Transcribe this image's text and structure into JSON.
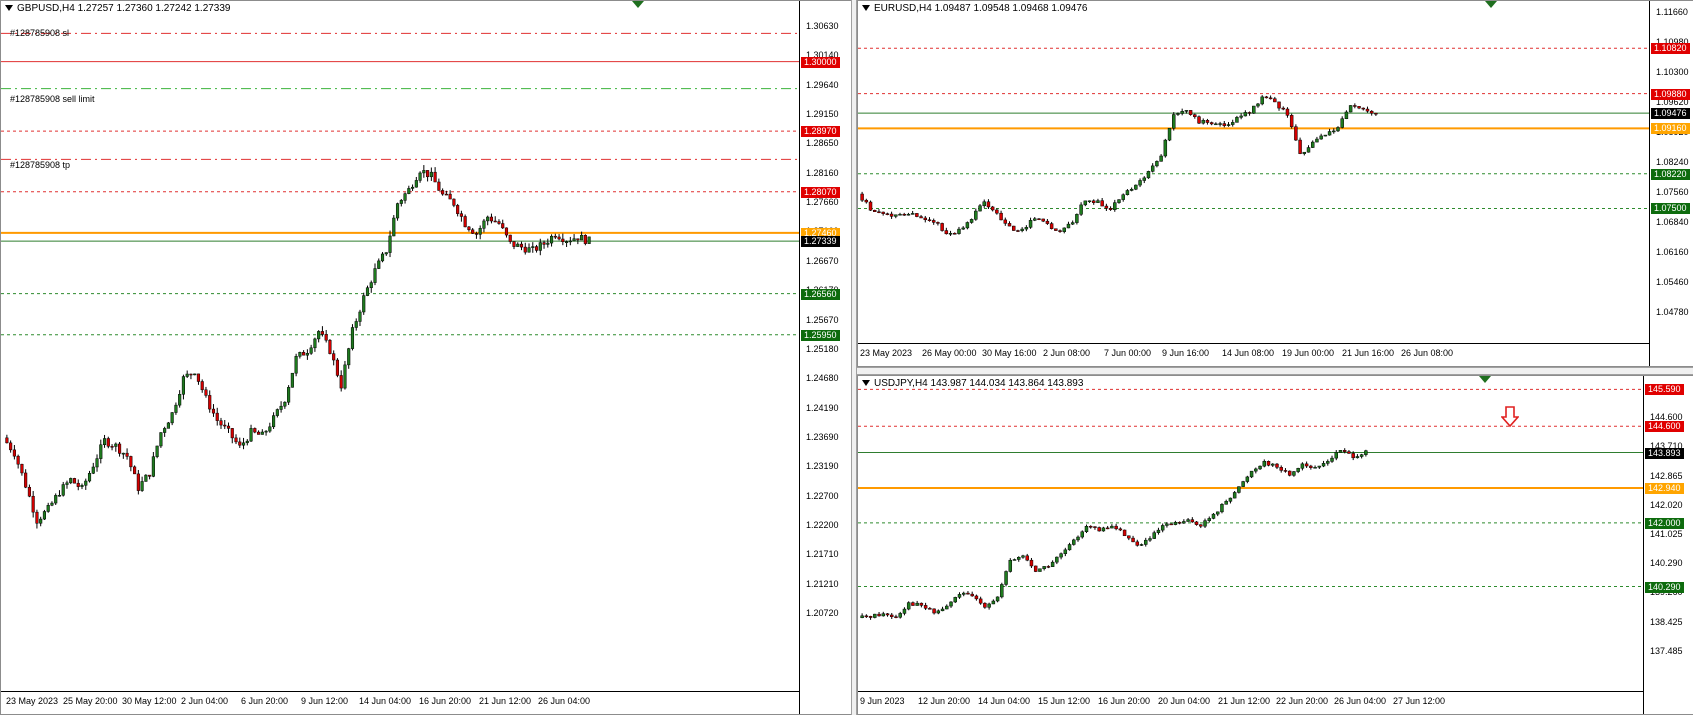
{
  "colors": {
    "bull": "#1e7a1e",
    "bear": "#d40000",
    "order_line": "#ff9a00",
    "sl_line": "#e03030",
    "tp_line": "#2e8b2e",
    "current_line": "#2f7d2f",
    "sl_tag": "#e00000",
    "tp_tag": "#0d6b0d",
    "current_tag": "#000000",
    "order_tag": "#ffa500"
  },
  "charts": [
    {
      "id": "gbpusd",
      "header": "GBPUSD,H4  1.27257 1.27360 1.27242 1.27339",
      "price_ticks": [
        "1.30630",
        "1.30140",
        "1.29640",
        "1.29150",
        "1.28650",
        "1.28160",
        "1.27660",
        "1.27160",
        "1.26670",
        "1.26170",
        "1.25670",
        "1.25180",
        "1.24680",
        "1.24190",
        "1.23690",
        "1.23190",
        "1.22700",
        "1.22200",
        "1.21710",
        "1.21210",
        "1.20720"
      ],
      "date_ticks": [
        "23 May 2023",
        "25 May 20:00",
        "30 May 12:00",
        "2 Jun 04:00",
        "6 Jun 20:00",
        "9 Jun 12:00",
        "14 Jun 04:00",
        "16 Jun 20:00",
        "21 Jun 12:00",
        "26 Jun 04:00"
      ],
      "annotations": [
        "#128785908 sl",
        "#128785908 sell limit",
        "#128785908 tp"
      ],
      "levels": [
        {
          "price": "1.30000",
          "kind": "red-solid",
          "tag": "sl"
        },
        {
          "price": "1.28970",
          "kind": "red-dash",
          "tag": "sl"
        },
        {
          "price": "1.28070",
          "kind": "red-dash",
          "tag": "sl"
        },
        {
          "price": "1.27460",
          "kind": "orange",
          "tag": "order"
        },
        {
          "price": "1.27339",
          "kind": "current",
          "tag": "current"
        },
        {
          "price": "1.26560",
          "kind": "green-dash",
          "tag": "tp"
        },
        {
          "price": "1.25950",
          "kind": "green-dash",
          "tag": "tp"
        }
      ]
    },
    {
      "id": "eurusd",
      "header": "EURUSD,H4  1.09487 1.09548 1.09468 1.09476",
      "price_ticks": [
        "1.11660",
        "1.10980",
        "1.10300",
        "1.09620",
        "1.08920",
        "1.08240",
        "1.07560",
        "1.06840",
        "1.06160",
        "1.05460",
        "1.04780"
      ],
      "date_ticks": [
        "23 May 2023",
        "26 May 00:00",
        "30 May 16:00",
        "2 Jun 08:00",
        "7 Jun 00:00",
        "9 Jun 16:00",
        "14 Jun 08:00",
        "19 Jun 00:00",
        "21 Jun 16:00",
        "26 Jun 08:00"
      ],
      "levels": [
        {
          "price": "1.10820",
          "kind": "red-dash",
          "tag": "sl"
        },
        {
          "price": "1.09880",
          "kind": "red-dash",
          "tag": "sl"
        },
        {
          "price": "1.09476",
          "kind": "current",
          "tag": "current"
        },
        {
          "price": "1.09160",
          "kind": "orange",
          "tag": "order"
        },
        {
          "price": "1.08220",
          "kind": "green-dash",
          "tag": "tp"
        },
        {
          "price": "1.07500",
          "kind": "green-dash",
          "tag": "tp"
        }
      ]
    },
    {
      "id": "usdjpy",
      "header": "USDJPY,H4  143.987 144.034 143.864 143.893",
      "price_ticks": [
        "145.445",
        "144.600",
        "143.710",
        "142.865",
        "142.020",
        "141.025",
        "140.290",
        "139.260",
        "138.425",
        "137.485"
      ],
      "date_ticks": [
        "9 Jun 2023",
        "12 Jun 20:00",
        "14 Jun 04:00",
        "15 Jun 12:00",
        "16 Jun 20:00",
        "20 Jun 04:00",
        "21 Jun 12:00",
        "22 Jun 20:00",
        "26 Jun 04:00",
        "27 Jun 12:00"
      ],
      "levels": [
        {
          "price": "145.590",
          "kind": "red-dash",
          "tag": "sl"
        },
        {
          "price": "144.600",
          "kind": "red-dash",
          "tag": "sl"
        },
        {
          "price": "143.893",
          "kind": "current",
          "tag": "current"
        },
        {
          "price": "142.940",
          "kind": "orange",
          "tag": "order"
        },
        {
          "price": "142.000",
          "kind": "green-dash",
          "tag": "tp"
        },
        {
          "price": "140.290",
          "kind": "green-dash",
          "tag": "tp"
        }
      ]
    }
  ],
  "chart_data": [
    {
      "type": "candlestick",
      "symbol": "GBPUSD",
      "timeframe": "H4",
      "ylim": [
        1.2065,
        1.309
      ],
      "close_path": [
        1.2442,
        1.242,
        1.2372,
        1.232,
        1.2336,
        1.2362,
        1.238,
        1.2366,
        1.2402,
        1.2438,
        1.243,
        1.2415,
        1.2368,
        1.239,
        1.245,
        1.2478,
        1.253,
        1.2542,
        1.25,
        1.2468,
        1.245,
        1.2428,
        1.245,
        1.2445,
        1.247,
        1.25,
        1.256,
        1.2572,
        1.26,
        1.2572,
        1.252,
        1.26,
        1.265,
        1.269,
        1.272,
        1.279,
        1.281,
        1.284,
        1.283,
        1.2802,
        1.279,
        1.276,
        1.2745,
        1.277,
        1.276,
        1.273,
        1.2725,
        1.272,
        1.273,
        1.2745,
        1.2736,
        1.274,
        1.2734
      ]
    },
    {
      "type": "candlestick",
      "symbol": "EURUSD",
      "timeframe": "H4",
      "ylim": [
        1.0465,
        1.118
      ],
      "close_path": [
        1.078,
        1.075,
        1.074,
        1.0735,
        1.074,
        1.0732,
        1.0725,
        1.0695,
        1.0705,
        1.073,
        1.0765,
        1.074,
        1.071,
        1.0705,
        1.073,
        1.0715,
        1.07,
        1.0725,
        1.077,
        1.0762,
        1.075,
        1.0775,
        1.08,
        1.0825,
        1.086,
        1.0945,
        1.0955,
        1.093,
        1.0928,
        1.092,
        1.0935,
        1.095,
        1.098,
        1.097,
        1.0945,
        1.086,
        1.0885,
        1.0905,
        1.092,
        1.0965,
        1.0955,
        1.0948
      ]
    },
    {
      "type": "candlestick",
      "symbol": "USDJPY",
      "timeframe": "H4",
      "ylim": [
        137.4,
        145.95
      ],
      "close_path": [
        139.45,
        139.5,
        139.55,
        139.48,
        139.85,
        139.78,
        139.58,
        139.75,
        140.1,
        140.02,
        139.78,
        140.0,
        140.98,
        141.12,
        140.72,
        140.85,
        141.15,
        141.5,
        141.95,
        141.78,
        141.92,
        141.7,
        141.38,
        141.58,
        141.9,
        141.98,
        142.05,
        141.95,
        142.2,
        142.6,
        142.95,
        143.4,
        143.65,
        143.5,
        143.3,
        143.6,
        143.45,
        143.68,
        143.95,
        143.8,
        143.89
      ]
    }
  ]
}
